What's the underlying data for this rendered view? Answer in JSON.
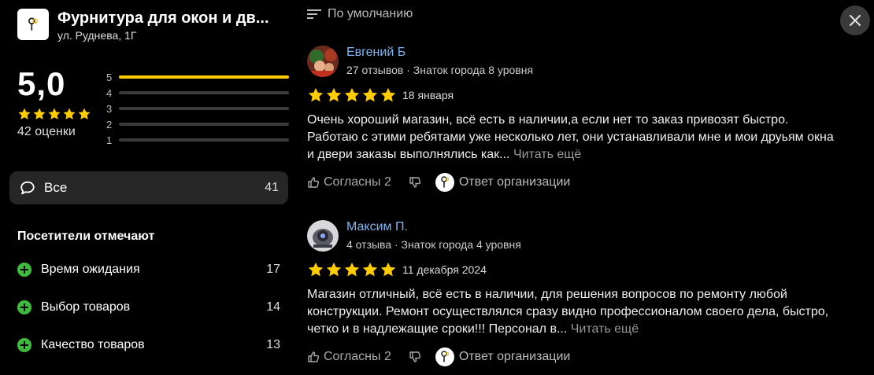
{
  "org": {
    "title": "Фурнитура для окон и дв...",
    "address": "ул. Руднева, 1Г",
    "logo_icon": "key-logo-icon",
    "logo_caption": "Фурнитура для окон и дверей"
  },
  "summary": {
    "rating": "5,0",
    "ratings_count_label": "42 оценки",
    "distribution": [
      {
        "stars": "5",
        "fraction": 1.0
      },
      {
        "stars": "4",
        "fraction": 0.0
      },
      {
        "stars": "3",
        "fraction": 0.0
      },
      {
        "stars": "2",
        "fraction": 0.0
      },
      {
        "stars": "1",
        "fraction": 0.0
      }
    ]
  },
  "filter": {
    "label": "Все",
    "count": "41",
    "icon": "chat-bubble-icon"
  },
  "visitors": {
    "title": "Посетители отмечают",
    "tags": [
      {
        "name": "Время ожидания",
        "count": "17"
      },
      {
        "name": "Выбор товаров",
        "count": "14"
      },
      {
        "name": "Качество товаров",
        "count": "13"
      }
    ]
  },
  "sort": {
    "label": "По умолчанию",
    "icon": "sort-lines-icon"
  },
  "reviews": [
    {
      "author": "Евгений Б",
      "meta": "27 отзывов · Знаток города 8 уровня",
      "rating": 5,
      "date": "18 января",
      "text": "Очень хороший магазин, всё есть в наличии,а если нет то заказ привозят быстро. Работаю с этими ребятами уже несколько лет, они устанавливали мне и мои друьям окна и двери заказы выполнялись как...",
      "more": "Читать ещё",
      "agree": "Согласны 2",
      "reply": "Ответ организации"
    },
    {
      "author": "Максим П.",
      "meta": "4 отзыва · Знаток города 4 уровня",
      "rating": 5,
      "date": "11 декабря 2024",
      "text": "Магазин отличный, всё есть в наличии, для решения вопросов по ремонту любой конструкции. Ремонт осуществлялся сразу видно профессионалом своего дела, быстро, четко и в надлежащие сроки!!! Персонал в...",
      "more": "Читать ещё",
      "agree": "Согласны 2",
      "reply": "Ответ организации"
    }
  ],
  "colors": {
    "star": "#ffcc00",
    "accent_link": "#7fb6f0",
    "plus_green": "#3dbb3d",
    "background": "#000000"
  }
}
